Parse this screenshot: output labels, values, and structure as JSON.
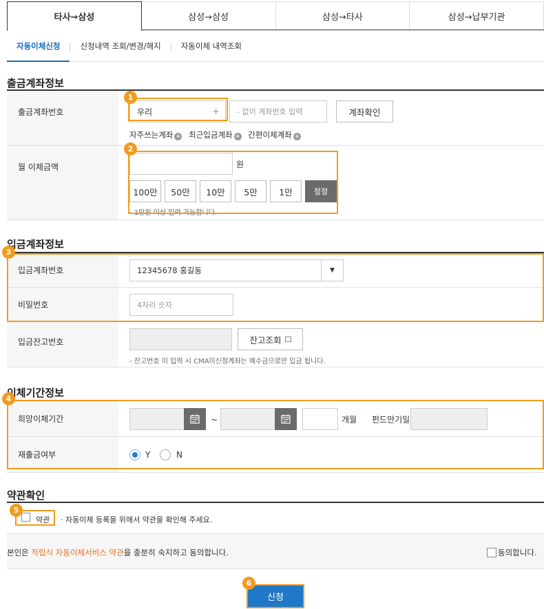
{
  "top_tabs": [
    "타사→삼성",
    "삼성→삼성",
    "삼성→타사",
    "삼성→납부기관"
  ],
  "sub_tabs": [
    "자동이체신청",
    "신청내역 조회/변경/해지",
    "자동이체 내역조회"
  ],
  "withdraw": {
    "title": "출금계좌정보",
    "account_label": "출금계좌번호",
    "bank_select": "우리",
    "account_placeholder": "- 없이 계좌번호 입력",
    "confirm_button": "계좌확인",
    "quick_links": [
      "자주쓰는계좌",
      "최근입금계좌",
      "간편이체계좌"
    ],
    "amount_label": "월 이체금액",
    "amount_unit": "원",
    "amount_buttons": [
      "100만",
      "50만",
      "10만",
      "5만",
      "1만",
      "정정"
    ],
    "amount_note": "- 1만원 이상 입력 가능합니다."
  },
  "deposit": {
    "title": "입금계좌정보",
    "account_label": "입금계좌번호",
    "account_value": "12345678 홍길동",
    "password_label": "비밀번호",
    "password_placeholder": "4자리 숫자",
    "balance_label": "입금잔고번호",
    "balance_button": "잔고조회",
    "balance_note": "- 잔고번호 미 입력 시 CMA미신청계좌는 예수금으로만 입금 됩니다."
  },
  "period": {
    "title": "이체기간정보",
    "period_label": "희망이체기간",
    "tilde": "~",
    "months_unit": "개월",
    "fund_label": "펀드만기일",
    "reorder_label": "재출금여부",
    "yes": "Y",
    "no": "N"
  },
  "terms": {
    "title": "약관확인",
    "checkbox_label": "약관",
    "notice": "· 자동이체 등록을 위해서 약관을 확인해 주세요.",
    "agree_prefix": "본인은 ",
    "agree_link": "적립식 자동이체서비스 약관",
    "agree_suffix": "을 충분히 숙지하고 동의합니다.",
    "agree_check": "동의합니다."
  },
  "submit_button": "신청",
  "badges": [
    "1",
    "2",
    "3",
    "4",
    "5",
    "6"
  ],
  "colors": {
    "accent": "#f29b1d",
    "primary": "#1f78c8",
    "link": "#e8731d"
  }
}
